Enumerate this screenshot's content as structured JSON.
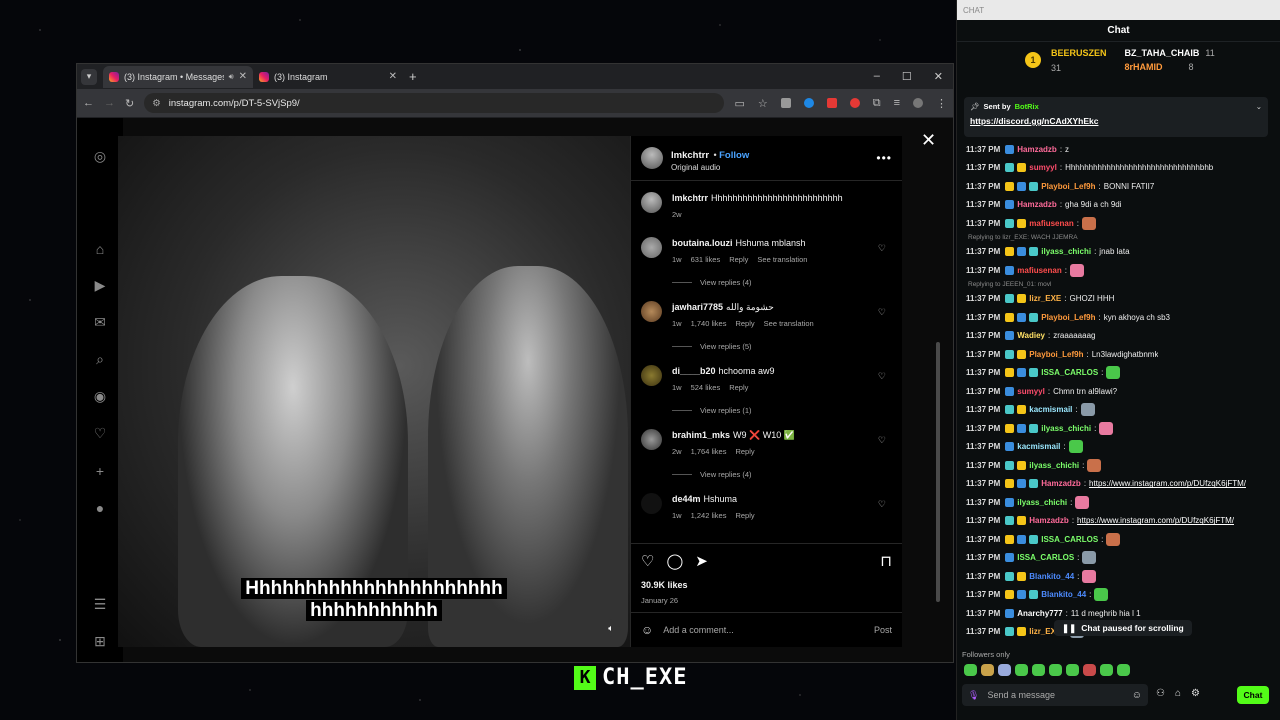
{
  "browser": {
    "tabs": [
      {
        "title": "(3) Instagram • Messages",
        "active": true
      },
      {
        "title": "(3) Instagram",
        "active": false
      }
    ],
    "url": "instagram.com/p/DT-5-SVjSp9/"
  },
  "post": {
    "username": "lmkchtrr",
    "follow_label": "Follow",
    "audio": "Original audio",
    "caption_user": "lmkchtrr",
    "caption_text": "Hhhhhhhhhhhhhhhhhhhhhhhhhh",
    "caption_age": "2w",
    "video_caption_line1": "Hhhhhhhhhhhhhhhhhhhhhh",
    "video_caption_line2": "hhhhhhhhhhh",
    "comments": [
      {
        "user": "boutaina.louzi",
        "text": "Hshuma mblansh",
        "age": "1w",
        "likes": "631 likes",
        "reply": "Reply",
        "translate": "See translation",
        "replies": "View replies (4)"
      },
      {
        "user": "jawhari7785",
        "text": "حشومة والله",
        "age": "1w",
        "likes": "1,740 likes",
        "reply": "Reply",
        "translate": "See translation",
        "replies": "View replies (5)"
      },
      {
        "user": "di____b20",
        "text": "hchooma aw9",
        "age": "1w",
        "likes": "524 likes",
        "reply": "Reply",
        "translate": "",
        "replies": "View replies (1)"
      },
      {
        "user": "brahim1_mks",
        "text": "W9 ❌ W10 ✅",
        "age": "2w",
        "likes": "1,764 likes",
        "reply": "Reply",
        "translate": "",
        "replies": "View replies (4)"
      },
      {
        "user": "de44m",
        "text": "Hshuma",
        "age": "1w",
        "likes": "1,242 likes",
        "reply": "Reply",
        "translate": "",
        "replies": ""
      }
    ],
    "likes": "30.9K likes",
    "date": "January 26",
    "add_comment_placeholder": "Add a comment...",
    "post_label": "Post"
  },
  "stream": {
    "channel": "CH_EXE"
  },
  "chat": {
    "topbar": "CHAT",
    "title": "Chat",
    "leaderboard": [
      {
        "rank": "1",
        "name": "BEERUSZEN",
        "count": "31"
      },
      {
        "rank": "",
        "name": "BZ_TAHA_CHAIB",
        "count": "11"
      },
      {
        "rank": "",
        "name": "8rHAMID",
        "count": "8"
      }
    ],
    "pinned": {
      "sent_by": "Sent by",
      "bot": "BotRix",
      "link": "https://discord.gg/nCAdXYhEkc"
    },
    "messages": [
      {
        "time": "11:37 PM",
        "user": "Hamzadzb",
        "color": "#ff6b9a",
        "text": "z",
        "reply": ""
      },
      {
        "time": "11:37 PM",
        "user": "sumyyl",
        "color": "#ff4d6d",
        "text": "Hhhhhhhhhhhhhhhhhhhhhhhhhhhhhhbhb",
        "reply": ""
      },
      {
        "time": "11:37 PM",
        "user": "Playboi_Lef9h",
        "color": "#ff9a3c",
        "text": "BONNI FATII7",
        "reply": ""
      },
      {
        "time": "11:37 PM",
        "user": "Hamzadzb",
        "color": "#ff6b9a",
        "text": "gha 9di a ch 9di",
        "reply": ""
      },
      {
        "time": "11:37 PM",
        "user": "mafiusenan",
        "color": "#ff4d4d",
        "text": "",
        "reply": ""
      },
      {
        "time": "11:37 PM",
        "user": "ilyass_chichi",
        "color": "#7cff6b",
        "text": "jnab lata",
        "reply": "Replying to lizr_EXE: WACH JJEMRA"
      },
      {
        "time": "11:37 PM",
        "user": "mafiusenan",
        "color": "#ff4d4d",
        "text": "",
        "reply": ""
      },
      {
        "time": "11:37 PM",
        "user": "lizr_EXE",
        "color": "#ffb347",
        "text": "GHOZI HHH",
        "reply": "Replying to JEEEN_01: movl"
      },
      {
        "time": "11:37 PM",
        "user": "Playboi_Lef9h",
        "color": "#ff9a3c",
        "text": "kyn akhoya ch sb3",
        "reply": ""
      },
      {
        "time": "11:37 PM",
        "user": "Wadiey",
        "color": "#ffe066",
        "text": "zraaaaaaag",
        "reply": ""
      },
      {
        "time": "11:37 PM",
        "user": "Playboi_Lef9h",
        "color": "#ff9a3c",
        "text": "Ln3lawdighatbnmk",
        "reply": ""
      },
      {
        "time": "11:37 PM",
        "user": "ISSA_CARLOS",
        "color": "#7cff6b",
        "text": "",
        "reply": ""
      },
      {
        "time": "11:37 PM",
        "user": "sumyyl",
        "color": "#ff4d6d",
        "text": "Chmn trn al9lawi?",
        "reply": ""
      },
      {
        "time": "11:37 PM",
        "user": "kacmismail",
        "color": "#9be8ff",
        "text": "",
        "reply": ""
      },
      {
        "time": "11:37 PM",
        "user": "ilyass_chichi",
        "color": "#7cff6b",
        "text": "",
        "reply": ""
      },
      {
        "time": "11:37 PM",
        "user": "kacmismail",
        "color": "#9be8ff",
        "text": "",
        "reply": ""
      },
      {
        "time": "11:37 PM",
        "user": "ilyass_chichi",
        "color": "#7cff6b",
        "text": "",
        "reply": ""
      },
      {
        "time": "11:37 PM",
        "user": "Hamzadzb",
        "color": "#ff6b9a",
        "text": "https://www.instagram.com/p/DUfzqK6jFTM/",
        "reply": ""
      },
      {
        "time": "11:37 PM",
        "user": "ilyass_chichi",
        "color": "#7cff6b",
        "text": "",
        "reply": ""
      },
      {
        "time": "11:37 PM",
        "user": "Hamzadzb",
        "color": "#ff6b9a",
        "text": "https://www.instagram.com/p/DUfzqK6jFTM/",
        "reply": ""
      },
      {
        "time": "11:37 PM",
        "user": "ISSA_CARLOS",
        "color": "#7cff6b",
        "text": "",
        "reply": ""
      },
      {
        "time": "11:37 PM",
        "user": "ISSA_CARLOS",
        "color": "#7cff6b",
        "text": "",
        "reply": ""
      },
      {
        "time": "11:37 PM",
        "user": "Blankito_44",
        "color": "#4d8bff",
        "text": "",
        "reply": ""
      },
      {
        "time": "11:37 PM",
        "user": "Blankito_44",
        "color": "#4d8bff",
        "text": "",
        "reply": ""
      },
      {
        "time": "11:37 PM",
        "user": "Anarchy777",
        "color": "#ffffff",
        "text": "11 d meghrib hia l 1",
        "reply": ""
      },
      {
        "time": "11:37 PM",
        "user": "lizr_EXE",
        "color": "#ffb347",
        "text": "",
        "reply": ""
      }
    ],
    "paused_label": "Chat paused for scrolling",
    "followers_only": "Followers only",
    "input_placeholder": "Send a message",
    "send_label": "Chat"
  }
}
